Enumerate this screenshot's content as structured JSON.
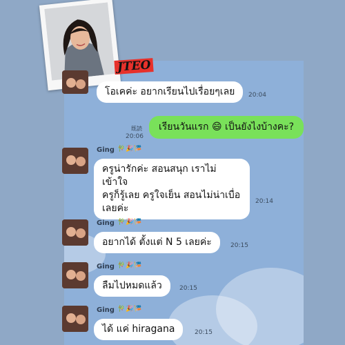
{
  "brand_label": "JTEO",
  "messages": [
    {
      "text": "โอเคค่ะ อยากเรียนไปเรื่อยๆเลย",
      "time": "20:04"
    },
    {
      "text": "เรียนวันแรก 😄 เป็นยังไงบ้างคะ?",
      "time": "20:06",
      "read": "既読",
      "outgoing": true
    },
    {
      "name": "Ging",
      "text": "ครูน่ารักค่ะ สอนสนุก เราไม่เข้าใจ\nครูก็รู้เลย ครูใจเย็น สอนไม่น่าเบื่อ\nเลยค่ะ",
      "time": "20:14"
    },
    {
      "name": "Ging",
      "text": "อยากได้ ตั้งแต่ N 5 เลยค่ะ",
      "time": "20:15"
    },
    {
      "name": "Ging",
      "text": "ลืมไปหมดแล้ว",
      "time": "20:15"
    },
    {
      "name": "Ging",
      "text": "ได้ แค่ hiragana",
      "time": "20:15"
    }
  ],
  "stickers": "🎋🎉🎏",
  "colors": {
    "chat_bg": "#8eb0d9",
    "outgoing_bubble": "#79e15a",
    "incoming_bubble": "#ffffff",
    "brand_bg": "#e7312b"
  }
}
